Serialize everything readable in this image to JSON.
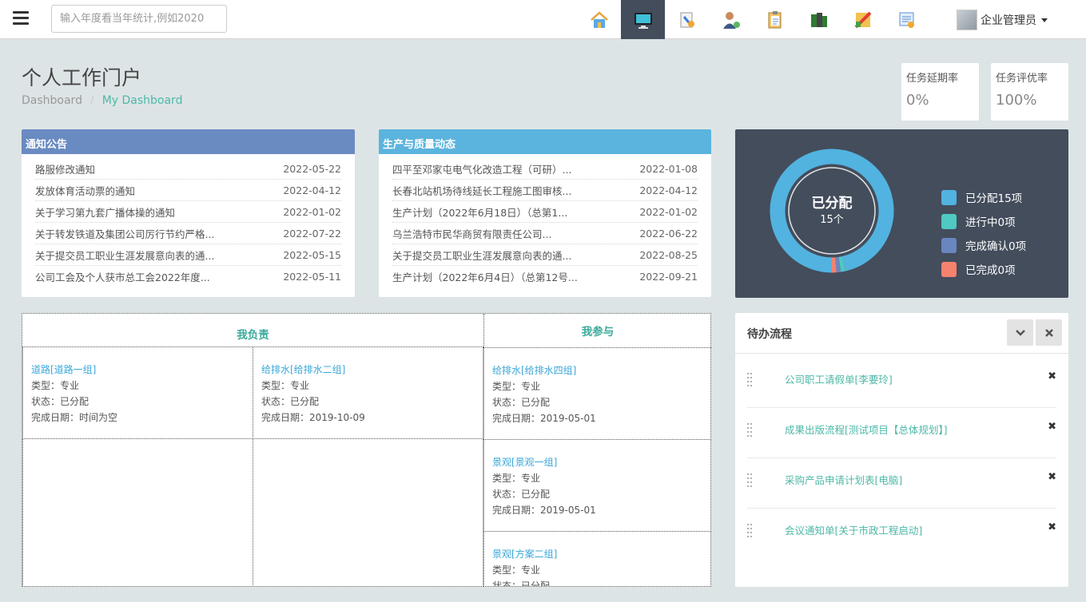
{
  "header": {
    "search_placeholder": "输入年度看当年统计,例如2020",
    "user_name": "企业管理员",
    "nav_icons": [
      "home-icon",
      "monitor-icon",
      "tools-icon",
      "user-settings-icon",
      "clipboard-icon",
      "books-icon",
      "reports-icon",
      "config-icon"
    ]
  },
  "page": {
    "title": "个人工作门户",
    "breadcrumb": {
      "home": "Dashboard",
      "separator": "/",
      "current": "My Dashboard"
    }
  },
  "stats": [
    {
      "label": "任务延期率",
      "value": "0%"
    },
    {
      "label": "任务评优率",
      "value": "100%"
    }
  ],
  "notices": {
    "title": "通知公告",
    "header_color": "#6a8ac2",
    "items": [
      {
        "title": "路服修改通知",
        "date": "2022-05-22"
      },
      {
        "title": "发放体育活动票的通知",
        "date": "2022-04-12"
      },
      {
        "title": "关于学习第九套广播体操的通知",
        "date": "2022-01-02"
      },
      {
        "title": "关于转发铁道及集团公司厉行节约严格...",
        "date": "2022-07-22"
      },
      {
        "title": "关于提交员工职业生涯发展意向表的通...",
        "date": "2022-05-15"
      },
      {
        "title": "公司工会及个人获市总工会2022年度...",
        "date": "2022-05-11"
      }
    ]
  },
  "production": {
    "title": "生产与质量动态",
    "header_color": "#5bb4de",
    "items": [
      {
        "title": "四平至邓家屯电气化改造工程（可研）...",
        "date": "2022-01-08"
      },
      {
        "title": "长春北站机场待线延长工程施工图审核...",
        "date": "2022-04-12"
      },
      {
        "title": "生产计划（2022年6月18日）（总第1...",
        "date": "2022-01-02"
      },
      {
        "title": "乌兰浩特市民华商贸有限责任公司...",
        "date": "2022-06-22"
      },
      {
        "title": "关于提交员工职业生涯发展意向表的通...",
        "date": "2022-08-25"
      },
      {
        "title": "生产计划（2022年6月4日）（总第12号...",
        "date": "2022-09-21"
      }
    ]
  },
  "chart_data": {
    "type": "pie",
    "variant": "donut",
    "center_label": "已分配",
    "center_value": "15个",
    "categories": [
      "已分配",
      "进行中",
      "完成确认",
      "已完成"
    ],
    "values": [
      15,
      0,
      0,
      0
    ],
    "legend": [
      "已分配15项",
      "进行中0项",
      "完成确认0项",
      "已完成0项"
    ],
    "colors": [
      "#52b3e0",
      "#4fc9c1",
      "#6a86c0",
      "#f4826e"
    ],
    "legend_position": "right"
  },
  "tasks": {
    "responsible_title": "我负责",
    "participate_title": "我参与",
    "responsible": [
      {
        "name": "道路[道路一组]",
        "type": "类型：专业",
        "status": "状态：已分配",
        "date": "完成日期：时间为空"
      },
      {
        "name": "给排水[给排水二组]",
        "type": "类型：专业",
        "status": "状态：已分配",
        "date": "完成日期：2019-10-09"
      }
    ],
    "participate": [
      {
        "name": "给排水[给排水四组]",
        "type": "类型：专业",
        "status": "状态：已分配",
        "date": "完成日期：2019-05-01"
      },
      {
        "name": "景观[景观一组]",
        "type": "类型：专业",
        "status": "状态：已分配",
        "date": "完成日期：2019-05-01"
      },
      {
        "name": "景观[方案二组]",
        "type": "类型：专业",
        "status": "状态：已分配",
        "date": ""
      }
    ]
  },
  "todo": {
    "title": "待办流程",
    "items": [
      {
        "label": "公司职工请假单[李要玲]"
      },
      {
        "label": "成果出版流程[测试项目【总体规划】]"
      },
      {
        "label": "采购产品申请计划表[电脑]"
      },
      {
        "label": "会议通知单[关于市政工程启动]"
      }
    ]
  }
}
